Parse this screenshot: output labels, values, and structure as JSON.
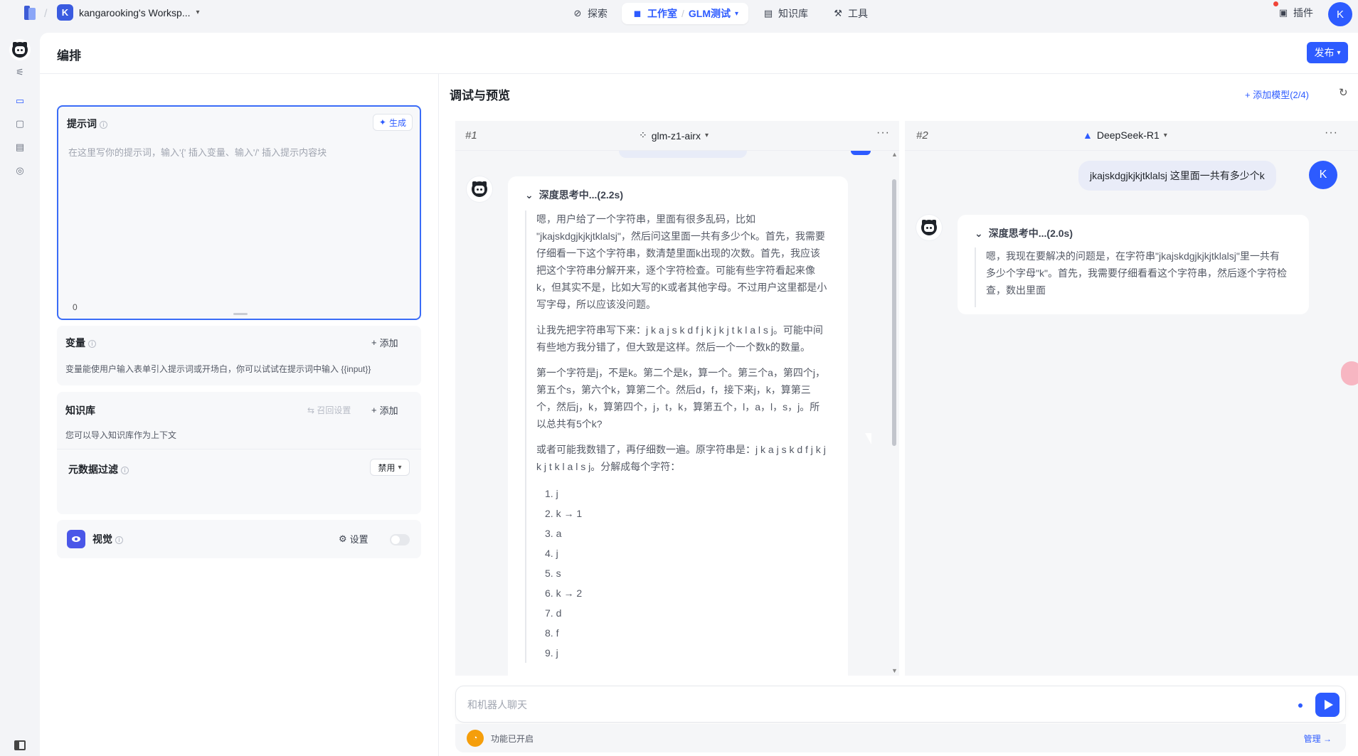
{
  "topbar": {
    "workspace_initial": "K",
    "workspace_name": "kangarooking's Worksp...",
    "nav": [
      {
        "label": "探索"
      },
      {
        "label": "工作室"
      },
      {
        "label": "GLM测试"
      },
      {
        "label": "知识库"
      },
      {
        "label": "工具"
      }
    ],
    "plugin_label": "插件",
    "user_initial": "K"
  },
  "header": {
    "title": "编排",
    "publish_label": "发布"
  },
  "prompt": {
    "title": "提示词",
    "generate_label": "生成",
    "placeholder": "在这里写你的提示词，输入'{' 插入变量、输入'/' 插入提示内容块",
    "count": "0"
  },
  "variables": {
    "title": "变量",
    "add_label": "添加",
    "desc": "变量能使用户输入表单引入提示词或开场白，你可以试试在提示词中输入 {{input}}"
  },
  "knowledge": {
    "title": "知识库",
    "recall_label": "召回设置",
    "add_label": "添加",
    "desc": "您可以导入知识库作为上下文"
  },
  "metadata_filter": {
    "title": "元数据过滤",
    "value": "禁用"
  },
  "vision": {
    "title": "视觉",
    "settings_label": "设置"
  },
  "debug": {
    "title": "调试与预览",
    "add_model_label": "添加模型(2/4)",
    "panes": [
      {
        "num": "#1",
        "model": "glm-z1-airx",
        "think_title": "深度思考中...(2.2s)",
        "paragraphs": [
          "嗯，用户给了一个字符串，里面有很多乱码，比如 \"jkajskdgjkjkjtklalsj\"，然后问这里面一共有多少个k。首先，我需要仔细看一下这个字符串，数清楚里面k出现的次数。首先，我应该把这个字符串分解开来，逐个字符检查。可能有些字符看起来像k，但其实不是，比如大写的K或者其他字母。不过用户这里都是小写字母，所以应该没问题。",
          "让我先把字符串写下来：j k a j s k d f j k j k j t k l a l s j。可能中间有些地方我分错了，但大致是这样。然后一个一个数k的数量。",
          "第一个字符是j，不是k。第二个是k，算一个。第三个a，第四个j，第五个s，第六个k，算第二个。然后d，f，接下来j，k，算第三个，然后j，k，算第四个，j，t，k，算第五个，l，a，l，s，j。所以总共有5个k?",
          "或者可能我数错了，再仔细数一遍。原字符串是：j k a j s k d f j k j k j t k l a l s j。分解成每个字符："
        ],
        "list": [
          "1. j",
          "2. k → 1",
          "3. a",
          "4. j",
          "5. s",
          "6. k → 2",
          "7. d",
          "8. f",
          "9. j"
        ]
      },
      {
        "num": "#2",
        "model": "DeepSeek-R1",
        "user_message": "jkajskdgjkjkjtklalsj 这里面一共有多少个k",
        "user_initial": "K",
        "think_title": "深度思考中...(2.0s)",
        "paragraph": "嗯，我现在要解决的问题是，在字符串\"jkajskdgjkjkjtklalsj\"里一共有多少个字母\"k\"。首先，我需要仔细看看这个字符串，然后逐个字符检查，数出里面"
      }
    ]
  },
  "chat": {
    "placeholder": "和机器人聊天",
    "feature_text": "功能已开启",
    "manage_label": "管理 →"
  }
}
